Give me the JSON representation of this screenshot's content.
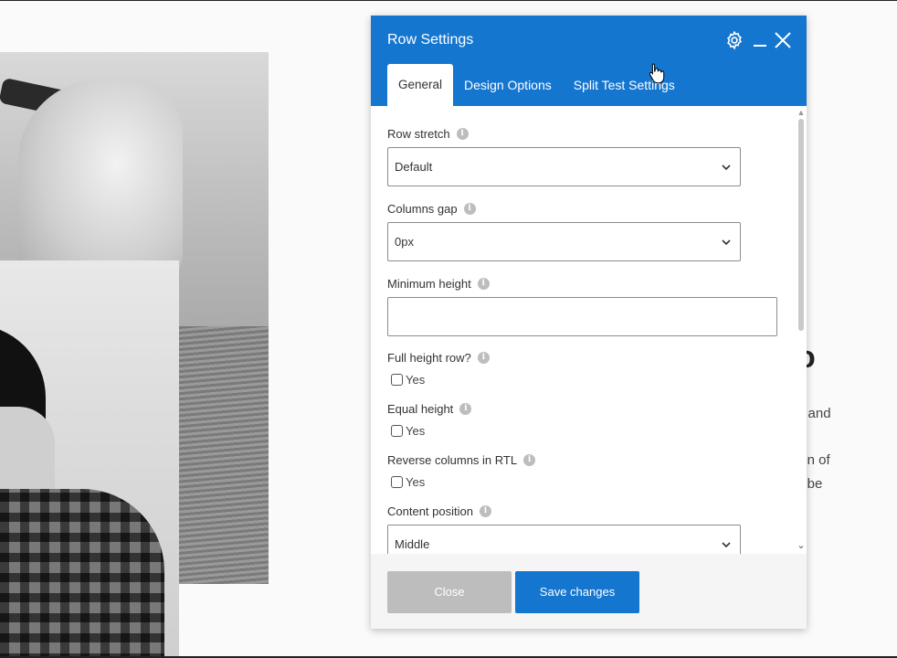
{
  "panel": {
    "title": "Row Settings",
    "icons": [
      "gear-icon",
      "minimize-icon",
      "close-icon"
    ],
    "accent_color": "#1576cf"
  },
  "tabs": [
    {
      "label": "General",
      "active": true
    },
    {
      "label": "Design Options",
      "active": false
    },
    {
      "label": "Split Test Settings",
      "active": false
    }
  ],
  "fields": {
    "row_stretch": {
      "label": "Row stretch",
      "value": "Default"
    },
    "columns_gap": {
      "label": "Columns gap",
      "value": "0px"
    },
    "minimum_height": {
      "label": "Minimum height",
      "value": ""
    },
    "full_height_row": {
      "label": "Full height row?",
      "option": "Yes",
      "checked": false
    },
    "equal_height": {
      "label": "Equal height",
      "option": "Yes",
      "checked": false
    },
    "reverse_columns_rtl": {
      "label": "Reverse columns in RTL",
      "option": "Yes",
      "checked": false
    },
    "content_position": {
      "label": "Content position",
      "value": "Middle"
    }
  },
  "footer": {
    "close_label": "Close",
    "save_label": "Save changes"
  },
  "background": {
    "heading_fragment": "o",
    "text_lines": [
      "e and",
      "ion of",
      "y be"
    ]
  }
}
